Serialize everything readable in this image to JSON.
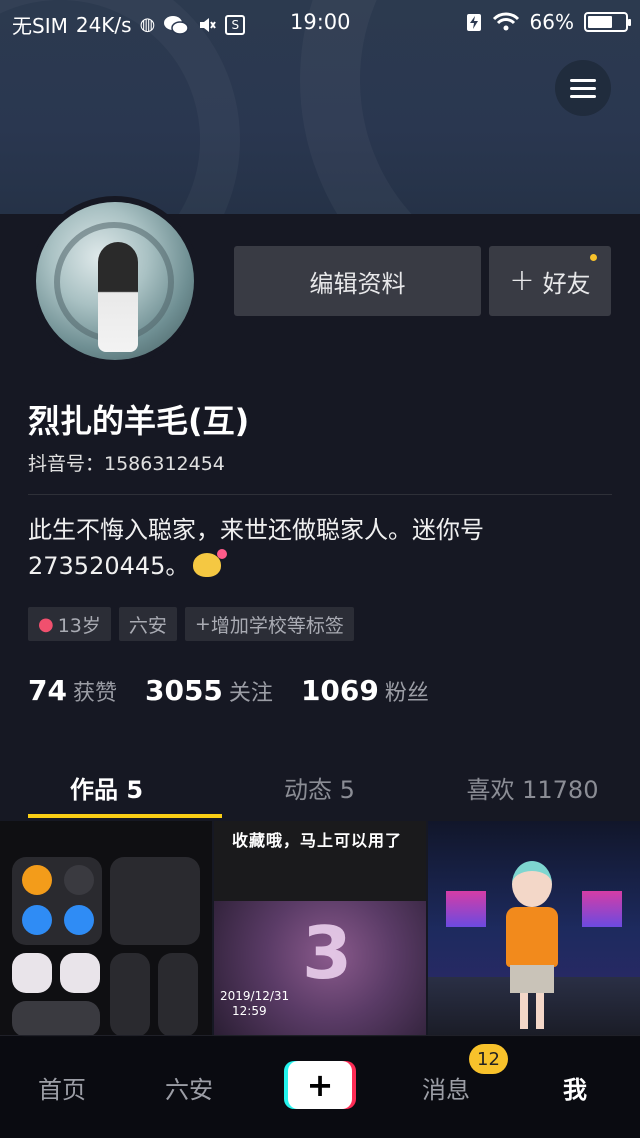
{
  "status_bar": {
    "carrier": "无SIM",
    "speed": "24K/s",
    "time": "19:00",
    "battery": "66%",
    "battery_level": 0.66,
    "battery_icon": "battery-icon",
    "wifi_icon": "wifi-icon",
    "wechat_icon": "wechat-icon"
  },
  "header": {
    "menu_icon": "hamburger-menu-icon"
  },
  "profile": {
    "avatar_icon": "avatar-photo",
    "edit_button": "编辑资料",
    "add_friend_button": "好友",
    "add_friend_icon": "+",
    "nickname": "烈扎的羊毛(互)",
    "douyin_id": "抖音号：1586312454",
    "bio_line1": "此生不悔入聪家，来世还做聪家人。迷你号",
    "bio_line2": "273520445。",
    "tags": [
      {
        "label": "13岁",
        "icon": "female-icon"
      },
      {
        "label": "六安"
      },
      {
        "label": "增加学校等标签",
        "icon": "+"
      }
    ],
    "stats": [
      {
        "num": "74",
        "label": "获赞"
      },
      {
        "num": "3055",
        "label": "关注"
      },
      {
        "num": "1069",
        "label": "粉丝"
      }
    ]
  },
  "tabs": [
    {
      "label": "作品 5",
      "active": true
    },
    {
      "label": "动态 5",
      "active": false
    },
    {
      "label": "喜欢 11780",
      "active": false
    }
  ],
  "grid": {
    "video2_caption": "收藏哦，马上可以用了",
    "video2_number": "3",
    "video2_date": "2019/12/31",
    "video2_time": "12:59"
  },
  "bottom_nav": {
    "home": "首页",
    "city": "六安",
    "plus": "+",
    "messages": "消息",
    "messages_badge": "12",
    "me": "我"
  },
  "colors": {
    "background": "#161823",
    "accent_yellow": "#face15",
    "tiktok_cyan": "#25f4ee",
    "tiktok_red": "#fe2c55"
  }
}
